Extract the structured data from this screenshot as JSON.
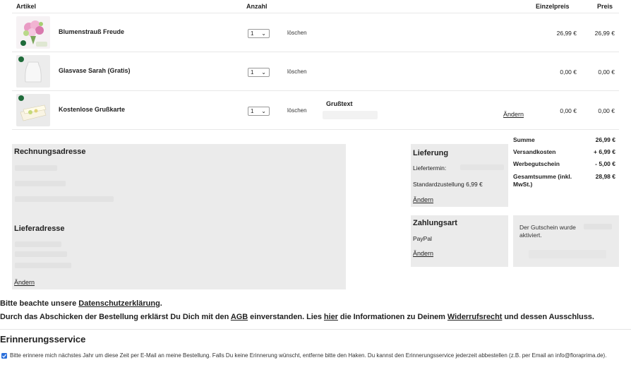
{
  "table": {
    "headers": {
      "article": "Artikel",
      "quantity": "Anzahl",
      "unit_price": "Einzelpreis",
      "price": "Preis"
    },
    "rows": [
      {
        "name": "Blumenstrauß Freude",
        "qty": "1",
        "delete": "löschen",
        "unit_price": "26,99 €",
        "price": "26,99 €"
      },
      {
        "name": "Glasvase Sarah (Gratis)",
        "qty": "1",
        "delete": "löschen",
        "unit_price": "0,00 €",
        "price": "0,00 €"
      },
      {
        "name": "Kostenlose Grußkarte",
        "qty": "1",
        "delete": "löschen",
        "unit_price": "0,00 €",
        "price": "0,00 €",
        "greeting_label": "Grußtext",
        "change": "Ändern"
      }
    ]
  },
  "address": {
    "billing_title": "Rechnungsadresse",
    "delivery_title": "Lieferadresse",
    "change": "Ändern"
  },
  "delivery": {
    "title": "Lieferung",
    "date_label": "Liefertermin:",
    "method": "Standardzustellung 6,99 €",
    "change": "Ändern"
  },
  "payment": {
    "title": "Zahlungsart",
    "method": "PayPal",
    "change": "Ändern"
  },
  "summary": {
    "rows": [
      {
        "label": "Summe",
        "value": "26,99 €"
      },
      {
        "label": "Versandkosten",
        "value": "+ 6,99 €"
      },
      {
        "label": "Werbegutschein",
        "value": "- 5,00 €"
      },
      {
        "label": "Gesamtsumme (inkl. MwSt.)",
        "value": "28,98 €"
      }
    ]
  },
  "voucher": {
    "message": "Der Gutschein wurde aktiviert."
  },
  "legal": {
    "privacy_prefix": "Bitte beachte unsere ",
    "privacy_link": "Datenschutzerklärung",
    "privacy_suffix": ".",
    "terms_1": "Durch das Abschicken der Bestellung erklärst Du Dich mit den ",
    "agb_link": "AGB",
    "terms_2": " einverstanden. Lies ",
    "hier_link": "hier",
    "terms_3": " die Informationen zu Deinem ",
    "withdrawal_link": "Widerrufsrecht",
    "terms_4": " und dessen Ausschluss."
  },
  "reminder": {
    "title": "Erinnerungsservice",
    "text": "Bitte erinnere mich nächstes Jahr um diese Zeit per E-Mail an meine Bestellung. Falls Du keine Erinnerung wünscht, entferne bitte den Haken. Du kannst den Erinnerungsservice jederzeit abbestellen (z.B. per Email an info@floraprima.de).",
    "checked": true
  },
  "colors": {
    "box_bg": "#ebebeb",
    "badge_green": "#1f6b3a",
    "checkbox_blue": "#2a6fdb"
  }
}
